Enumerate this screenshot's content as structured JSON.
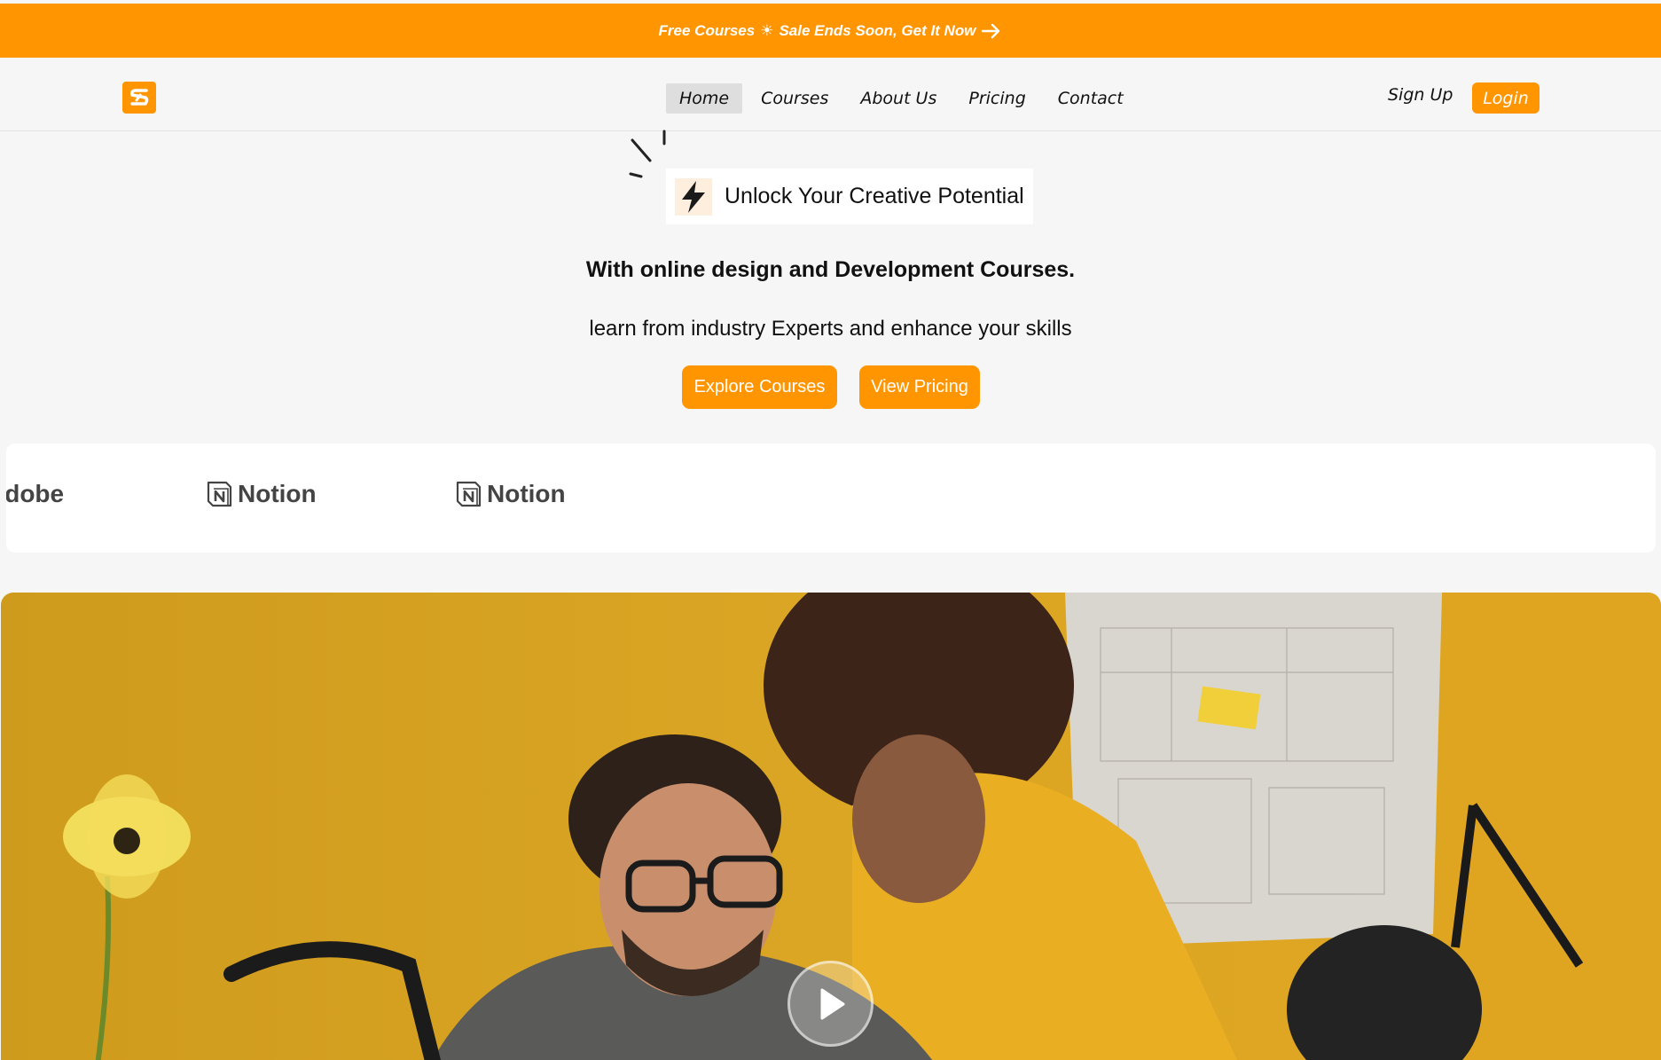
{
  "banner": {
    "text_before": "Free Courses",
    "sun_icon": "☀",
    "text_after": "Sale Ends Soon, Get It Now",
    "icon": "arrow-right-icon"
  },
  "nav": {
    "logo_icon": "s-logo-icon",
    "links": [
      {
        "label": "Home",
        "active": true
      },
      {
        "label": "Courses",
        "active": false
      },
      {
        "label": "About Us",
        "active": false
      },
      {
        "label": "Pricing",
        "active": false
      },
      {
        "label": "Contact",
        "active": false
      }
    ],
    "signup_label": "Sign Up",
    "login_label": "Login"
  },
  "hero": {
    "tag_icon": "lightning-bolt-icon",
    "tag_text": "Unlock Your Creative Potential",
    "headline": "With online design and Development Courses.",
    "subheadline": "learn from industry Experts and enhance your skills",
    "explore_label": "Explore Courses",
    "pricing_label": "View Pricing"
  },
  "brands": {
    "items": [
      "Adobe",
      "Notion",
      "Notion"
    ]
  },
  "video": {
    "play_icon": "play-icon"
  },
  "colors": {
    "accent": "#ff9500",
    "background": "#f6f6f6",
    "photo_backdrop": "#d9a21f"
  }
}
